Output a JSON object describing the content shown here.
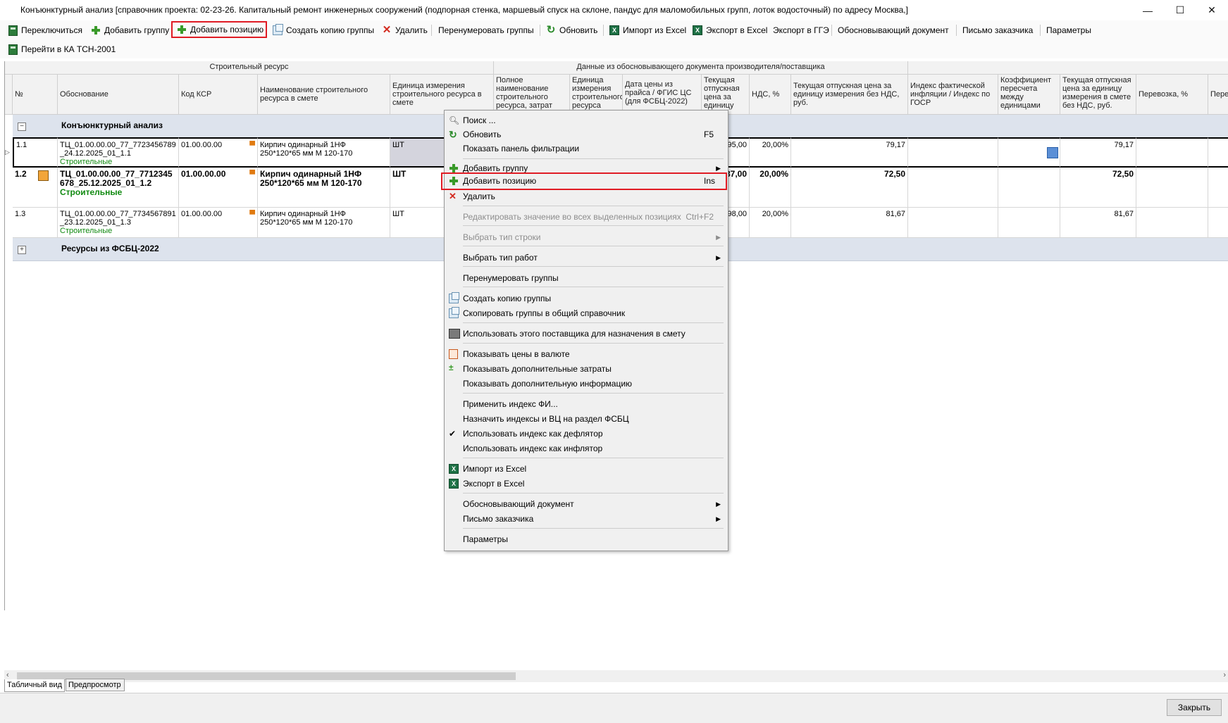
{
  "window": {
    "title": "Конъюнктурный анализ [справочник проекта: 02-23-26. Капитальный ремонт инженерных сооружений (подпорная стенка, маршевый спуск на склоне, пандус для маломобильных групп, лоток водосточный) по адресу Москва,]",
    "minimize": "—",
    "maximize": "☐",
    "close": "✕"
  },
  "toolbar": {
    "switch": "Переключиться",
    "add_group": "Добавить группу",
    "add_position": "Добавить позицию",
    "copy_group": "Создать копию группы",
    "delete": "Удалить",
    "renumber": "Перенумеровать группы",
    "refresh": "Обновить",
    "import_excel": "Импорт из Excel",
    "export_excel": "Экспорт в Excel",
    "export_gge": "Экспорт в ГГЭ",
    "justifying_doc": "Обосновывающий документ",
    "customer_letter": "Письмо заказчика",
    "params": "Параметры",
    "go_tsn": "Перейти в КА ТСН-2001"
  },
  "grid": {
    "group_headers": {
      "construction_resource": "Строительный ресурс",
      "manufacturer_data": "Данные из обосновывающего документа производителя/поставщика"
    },
    "columns": {
      "num": "№",
      "basis": "Обоснование",
      "ksr": "Код КСР",
      "name": "Наименование строительного ресурса в смете",
      "unit": "Единица измерения строительного ресурса в смете",
      "full_name": "Полное наименование строительного ресурса, затрат",
      "unit_res": "Единица измерения строительного ресурса",
      "date": "Дата цены из прайса / ФГИС ЦС (для ФСБЦ-2022)",
      "cur_price": "Текущая отпускная цена за единицу",
      "vat": "НДС, %",
      "cur_price_novat": "Текущая отпускная цена за единицу измерения без НДС, руб.",
      "index": "Индекс фактической инфляции / Индекс по ГОСР",
      "coef": "Коэффициент пересчета между единицами",
      "cur_price_est": "Текущая отпускная цена за единицу измерения в смете без НДС, руб.",
      "transport": "Перевозка, %",
      "transport2": "Пере"
    },
    "groups": [
      {
        "expander": "−",
        "title": "Конъюнктурный анализ"
      },
      {
        "expander": "+",
        "title": "Ресурсы из ФСБЦ-2022"
      }
    ],
    "rows": [
      {
        "num": "1.1",
        "basis": "ТЦ_01.00.00.00_77_7723456789_24.12.2025_01_1.1",
        "type": "Строительные",
        "ksr": "01.00.00.00",
        "name": "Кирпич одинарный 1НФ 250*120*65 мм М 120-170",
        "unit": "ШТ",
        "cur_price": "95,00",
        "vat": "20,00%",
        "price_novat": "79,17",
        "price_est": "79,17"
      },
      {
        "num": "1.2",
        "basis": "ТЦ_01.00.00.00_77_7712345678_25.12.2025_01_1.2",
        "type": "Строительные",
        "ksr": "01.00.00.00",
        "name": "Кирпич одинарный 1НФ 250*120*65 мм М 120-170",
        "unit": "ШТ",
        "cur_price": "87,00",
        "vat": "20,00%",
        "price_novat": "72,50",
        "price_est": "72,50"
      },
      {
        "num": "1.3",
        "basis": "ТЦ_01.00.00.00_77_7734567891_23.12.2025_01_1.3",
        "type": "Строительные",
        "ksr": "01.00.00.00",
        "name": "Кирпич одинарный 1НФ 250*120*65 мм М 120-170",
        "unit": "ШТ",
        "cur_price": "98,00",
        "vat": "20,00%",
        "price_novat": "81,67",
        "price_est": "81,67"
      }
    ]
  },
  "context_menu": {
    "search": "Поиск ...",
    "refresh": "Обновить",
    "refresh_key": "F5",
    "show_filter": "Показать панель фильтрации",
    "add_group": "Добавить группу",
    "add_position": "Добавить позицию",
    "add_position_key": "Ins",
    "delete": "Удалить",
    "edit_all": "Редактировать значение во всех выделенных позициях",
    "edit_all_key": "Ctrl+F2",
    "row_type": "Выбрать тип строки",
    "work_type": "Выбрать тип работ",
    "renumber": "Перенумеровать группы",
    "copy_group": "Создать копию группы",
    "copy_to_common": "Скопировать группы в общий справочник",
    "use_supplier": "Использовать этого поставщика для назначения в смету",
    "currency": "Показывать цены в валюте",
    "extra_costs": "Показывать дополнительные затраты",
    "extra_info": "Показывать дополнительную информацию",
    "apply_fi": "Применить индекс ФИ...",
    "assign_indexes": "Назначить индексы и ВЦ на раздел ФСБЦ",
    "deflator": "Использовать индекс как дефлятор",
    "inflator": "Использовать индекс как инфлятор",
    "import_excel": "Импорт из Excel",
    "export_excel": "Экспорт в Excel",
    "justifying_doc": "Обосновывающий документ",
    "customer_letter": "Письмо заказчика",
    "params": "Параметры"
  },
  "tabs": {
    "table_view": "Табличный вид",
    "preview": "Предпросмотр"
  },
  "footer": {
    "close": "Закрыть"
  },
  "colors": {
    "highlight": "#e01b24",
    "group_row": "#dde3ed",
    "green": "#118a11"
  }
}
